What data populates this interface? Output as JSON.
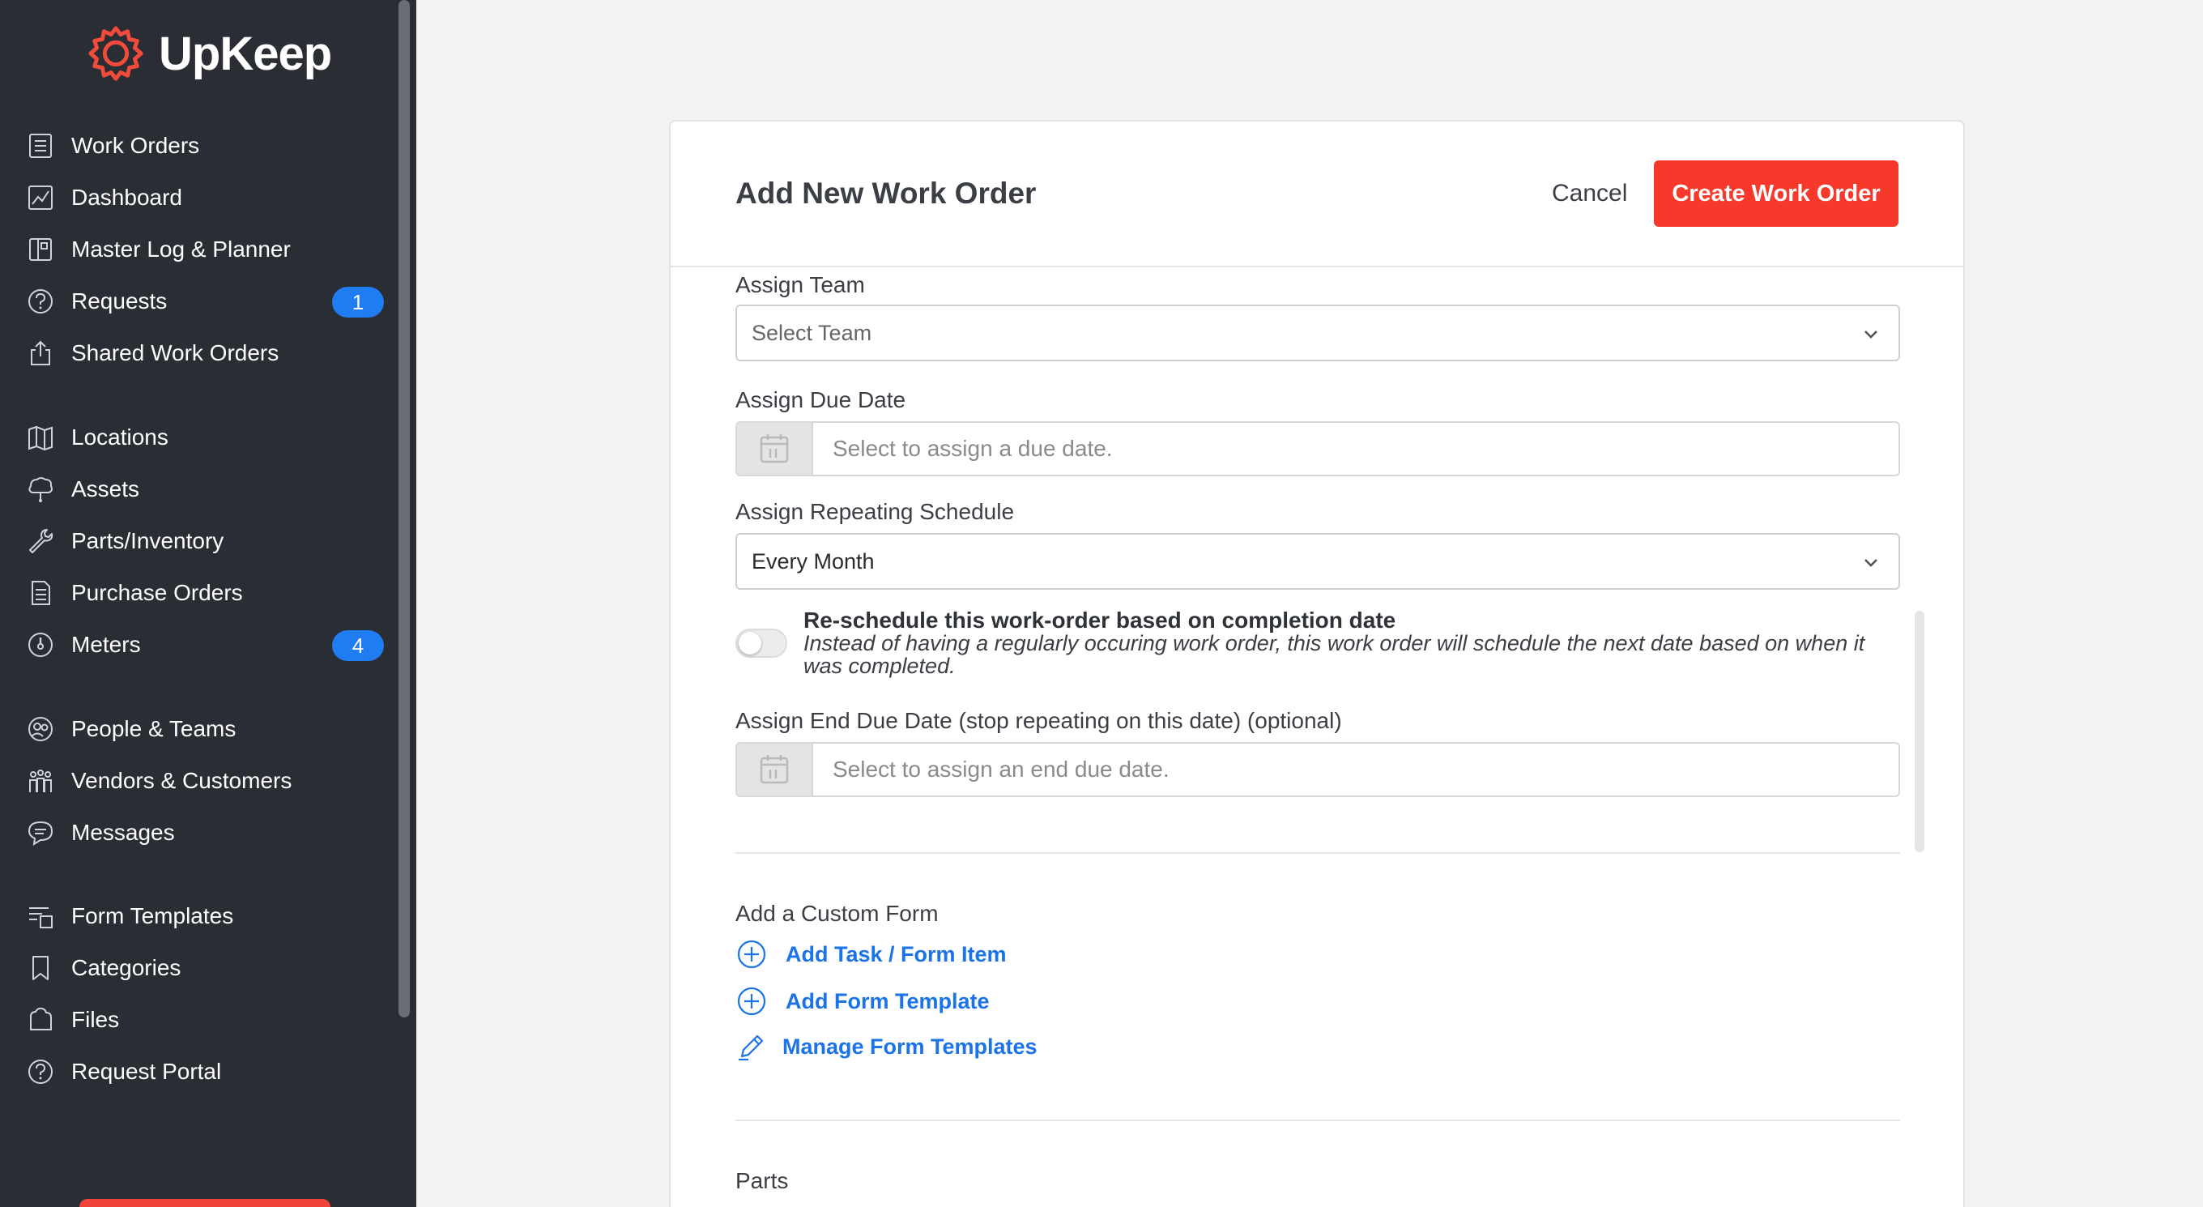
{
  "app": {
    "logo_text": "UpKeep"
  },
  "colors": {
    "sidebar_bg": "#2a2d33",
    "accent_red": "#f7392c",
    "link_blue": "#1a73e8",
    "badge_blue": "#1f7cf2"
  },
  "sidebar": {
    "groups": [
      [
        {
          "label": "Work Orders",
          "icon": "list-icon"
        },
        {
          "label": "Dashboard",
          "icon": "chart-icon"
        },
        {
          "label": "Master Log & Planner",
          "icon": "book-icon"
        },
        {
          "label": "Requests",
          "icon": "question-icon",
          "badge": "1"
        },
        {
          "label": "Shared Work Orders",
          "icon": "share-icon"
        }
      ],
      [
        {
          "label": "Locations",
          "icon": "map-icon"
        },
        {
          "label": "Assets",
          "icon": "cube-icon"
        },
        {
          "label": "Parts/Inventory",
          "icon": "wrench-icon"
        },
        {
          "label": "Purchase Orders",
          "icon": "document-icon"
        },
        {
          "label": "Meters",
          "icon": "gauge-icon",
          "badge": "4"
        }
      ],
      [
        {
          "label": "People & Teams",
          "icon": "people-icon"
        },
        {
          "label": "Vendors & Customers",
          "icon": "group-icon"
        },
        {
          "label": "Messages",
          "icon": "chat-icon"
        }
      ],
      [
        {
          "label": "Form Templates",
          "icon": "template-icon"
        },
        {
          "label": "Categories",
          "icon": "bookmark-icon"
        },
        {
          "label": "Files",
          "icon": "files-icon"
        },
        {
          "label": "Request Portal",
          "icon": "help-icon"
        }
      ]
    ]
  },
  "modal": {
    "title": "Add New Work Order",
    "cancel_label": "Cancel",
    "create_label": "Create Work Order",
    "assign_team": {
      "label": "Assign Team",
      "placeholder": "Select Team"
    },
    "due_date": {
      "label": "Assign Due Date",
      "placeholder": "Select to assign a due date."
    },
    "repeating": {
      "label": "Assign Repeating Schedule",
      "value": "Every Month"
    },
    "reschedule": {
      "title": "Re-schedule this work-order based on completion date",
      "description": "Instead of having a regularly occuring work order, this work order will schedule the next date based on when it was completed.",
      "enabled": false
    },
    "end_due_date": {
      "label": "Assign End Due Date (stop repeating on this date) (optional)",
      "placeholder": "Select to assign an end due date."
    },
    "custom_form": {
      "label": "Add a Custom Form",
      "add_task": "Add Task / Form Item",
      "add_template": "Add Form Template",
      "manage_templates": "Manage Form Templates"
    },
    "parts_label": "Parts"
  }
}
